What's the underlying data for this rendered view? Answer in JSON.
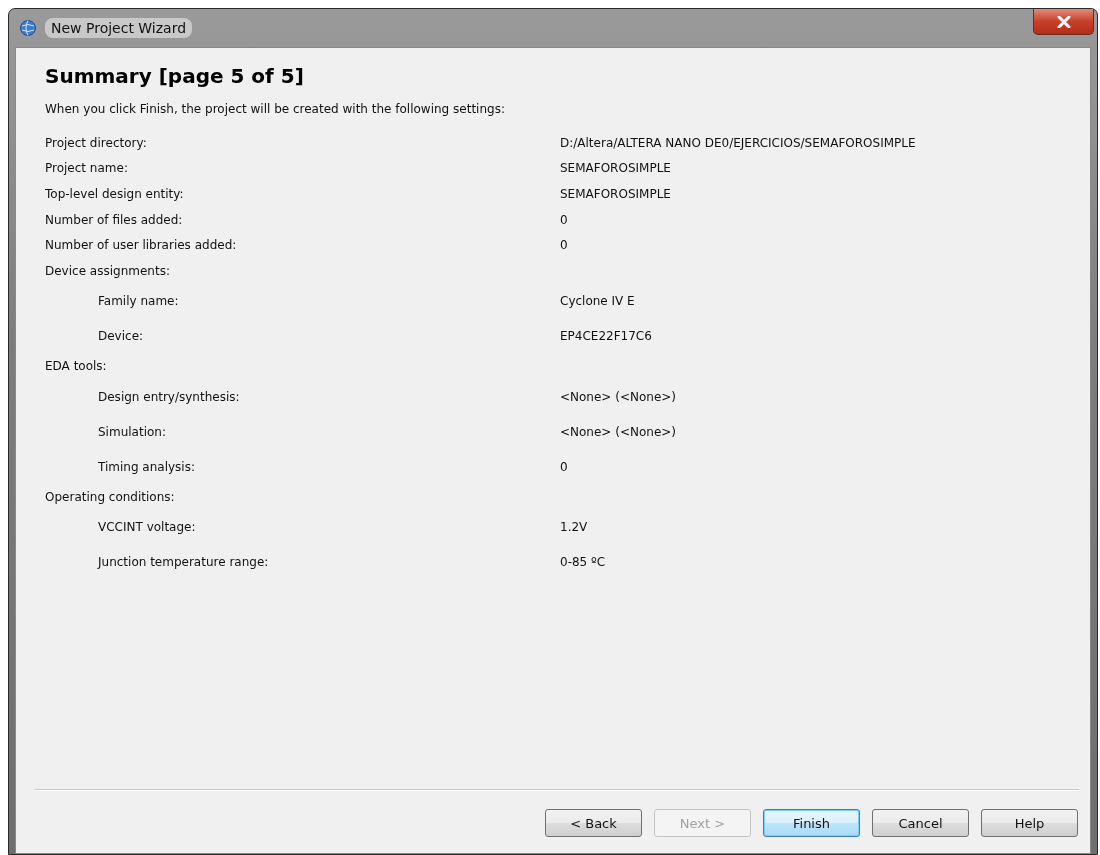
{
  "window": {
    "title": "New Project Wizard"
  },
  "heading": "Summary [page 5 of 5]",
  "intro": "When you click Finish, the project will be created with the following settings:",
  "settings": [
    {
      "label": "Project directory:",
      "value": "D:/Altera/ALTERA NANO DE0/EJERCICIOS/SEMAFOROSIMPLE"
    },
    {
      "label": "Project name:",
      "value": "SEMAFOROSIMPLE"
    },
    {
      "label": "Top-level design entity:",
      "value": "SEMAFOROSIMPLE"
    },
    {
      "label": "Number of files added:",
      "value": "0"
    },
    {
      "label": "Number of user libraries added:",
      "value": "0"
    },
    {
      "label": "Device assignments:",
      "children": [
        {
          "label": "Family name:",
          "value": "Cyclone IV E"
        },
        {
          "label": "Device:",
          "value": "EP4CE22F17C6"
        }
      ]
    },
    {
      "label": "EDA tools:",
      "children": [
        {
          "label": "Design entry/synthesis:",
          "value": "<None> (<None>)"
        },
        {
          "label": "Simulation:",
          "value": "<None> (<None>)"
        },
        {
          "label": "Timing analysis:",
          "value": "0"
        }
      ]
    },
    {
      "label": "Operating conditions:",
      "children": [
        {
          "label": "VCCINT voltage:",
          "value": "1.2V"
        },
        {
          "label": "Junction temperature range:",
          "value": "0-85 ºC"
        }
      ]
    }
  ],
  "buttons": [
    {
      "label": "< Back",
      "disabled": false,
      "default": false
    },
    {
      "label": "Next >",
      "disabled": true,
      "default": false
    },
    {
      "label": "Finish",
      "disabled": false,
      "default": true
    },
    {
      "label": "Cancel",
      "disabled": false,
      "default": false
    },
    {
      "label": "Help",
      "disabled": false,
      "default": false
    }
  ]
}
